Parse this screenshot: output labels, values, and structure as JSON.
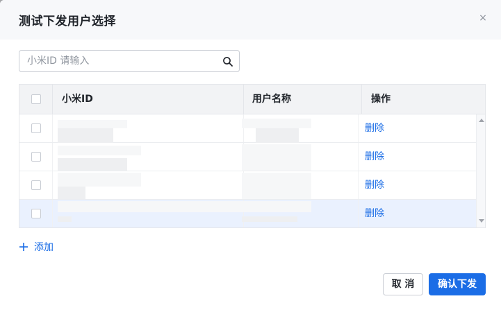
{
  "dialog": {
    "title": "测试下发用户选择",
    "close_glyph": "×"
  },
  "search": {
    "label": "小米ID",
    "placeholder": "请输入",
    "value": ""
  },
  "table": {
    "headers": {
      "id": "小米ID",
      "name": "用户名称",
      "action": "操作"
    },
    "rows": [
      {
        "delete_label": "删除",
        "selected": false
      },
      {
        "delete_label": "删除",
        "selected": false
      },
      {
        "delete_label": "删除",
        "selected": false
      },
      {
        "delete_label": "删除",
        "selected": true
      }
    ]
  },
  "add": {
    "label": "添加",
    "icon": "plus-icon"
  },
  "footer": {
    "cancel_label": "取 消",
    "confirm_label": "确认下发"
  },
  "colors": {
    "accent": "#1b6de6",
    "header_bg": "#f7f8fa",
    "selected_row": "#eaf1fe"
  }
}
